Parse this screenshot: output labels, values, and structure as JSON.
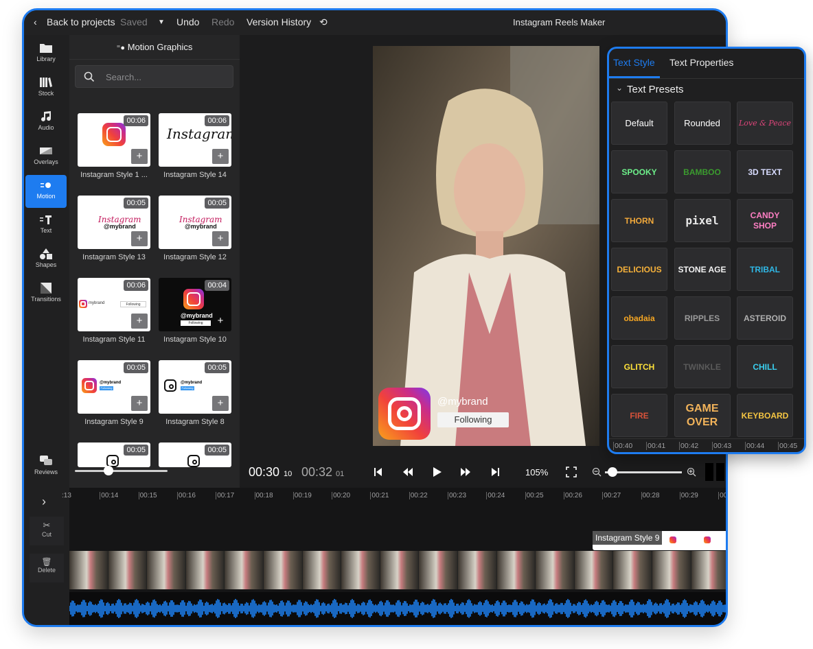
{
  "colors": {
    "accent": "#1e7cf0",
    "background": "#1b1b1c",
    "panel": "#262627"
  },
  "topbar": {
    "back_label": "Back to projects",
    "saved_label": "Saved",
    "undo_label": "Undo",
    "redo_label": "Redo",
    "history_label": "Version History",
    "title": "Instagram Reels Maker"
  },
  "sidebar": {
    "items": [
      {
        "label": "Library",
        "icon": "folder-icon"
      },
      {
        "label": "Stock",
        "icon": "books-icon"
      },
      {
        "label": "Audio",
        "icon": "music-note-icon"
      },
      {
        "label": "Overlays",
        "icon": "overlay-icon"
      },
      {
        "label": "Motion",
        "icon": "motion-icon",
        "active": true
      },
      {
        "label": "Text",
        "icon": "text-icon"
      },
      {
        "label": "Shapes",
        "icon": "shapes-icon"
      },
      {
        "label": "Transitions",
        "icon": "transitions-icon"
      }
    ],
    "reviews_label": "Reviews"
  },
  "motion_panel": {
    "title": "Motion Graphics",
    "search_placeholder": "Search...",
    "items": [
      {
        "label": "Instagram Style 1 ...",
        "duration": "00:06",
        "art": "logo"
      },
      {
        "label": "Instagram Style 14",
        "duration": "00:06",
        "art": "script"
      },
      {
        "label": "Instagram Style 13",
        "duration": "00:05",
        "art": "script-brand"
      },
      {
        "label": "Instagram Style 12",
        "duration": "00:05",
        "art": "script-brand"
      },
      {
        "label": "Instagram Style 11",
        "duration": "00:06",
        "art": "row"
      },
      {
        "label": "Instagram Style 10",
        "duration": "00:04",
        "art": "dark"
      },
      {
        "label": "Instagram Style 9",
        "duration": "00:05",
        "art": "badge"
      },
      {
        "label": "Instagram Style 8",
        "duration": "00:05",
        "art": "badge-outline"
      },
      {
        "label": "",
        "duration": "00:05",
        "art": "outline"
      },
      {
        "label": "",
        "duration": "00:05",
        "art": "outline"
      }
    ],
    "thumb_text": {
      "brand": "mybrand",
      "tag": "@mybrand",
      "follow": "Following",
      "script": "Instagram"
    }
  },
  "preview": {
    "overlay_handle": "@mybrand",
    "overlay_button": "Following"
  },
  "playback": {
    "current_time": "00:30",
    "current_frames": "10",
    "total_time": "00:32",
    "total_frames": "01",
    "zoom": "105%",
    "timeline_zoom": 0.1
  },
  "timeline": {
    "ticks": [
      ":13",
      "00:14",
      "00:15",
      "00:16",
      "00:17",
      "00:18",
      "00:19",
      "00:20",
      "00:21",
      "00:22",
      "00:23",
      "00:24",
      "00:25",
      "00:26",
      "00:27",
      "00:28",
      "00:29",
      "00"
    ],
    "clip_label": "Instagram Style 9",
    "tools": {
      "cut": "Cut",
      "delete": "Delete"
    }
  },
  "text_panel": {
    "tabs": [
      "Text Style",
      "Text Properties"
    ],
    "section": "Text Presets",
    "presets": [
      {
        "label": "Default",
        "color": "#ffffff"
      },
      {
        "label": "Rounded",
        "color": "#ffffff"
      },
      {
        "label": "Love & Peace",
        "color": "#e0457b"
      },
      {
        "label": "SPOOKY",
        "color": "#6df08a"
      },
      {
        "label": "BAMBOO",
        "color": "#3b9b2e"
      },
      {
        "label": "3D TEXT",
        "color": "#d8dcff"
      },
      {
        "label": "THORN",
        "color": "#f2a93b"
      },
      {
        "label": "pixel",
        "color": "#e8e8e8"
      },
      {
        "label": "CANDY SHOP",
        "color": "#ff7fc4"
      },
      {
        "label": "DELICIOUS",
        "color": "#f6b13a"
      },
      {
        "label": "STONE AGE",
        "color": "#f2f2f2"
      },
      {
        "label": "TRIBAL",
        "color": "#2fb8e6"
      },
      {
        "label": "obadaia",
        "color": "#f5a623"
      },
      {
        "label": "RIPPLES",
        "color": "#9a9a9a"
      },
      {
        "label": "ASTEROID",
        "color": "#b0b0b0"
      },
      {
        "label": "GLITCH",
        "color": "#ffe23a"
      },
      {
        "label": "TWINKLE",
        "color": "#5a5a5a"
      },
      {
        "label": "CHILL",
        "color": "#3ad0f0"
      },
      {
        "label": "FIRE",
        "color": "#d8523a"
      },
      {
        "label": "GAME OVER",
        "color": "#f2b35a"
      },
      {
        "label": "KEYBOARD",
        "color": "#f5c542"
      }
    ],
    "ruler": [
      "00:40",
      "00:41",
      "00:42",
      "00:43",
      "00:44",
      "00:45"
    ]
  }
}
